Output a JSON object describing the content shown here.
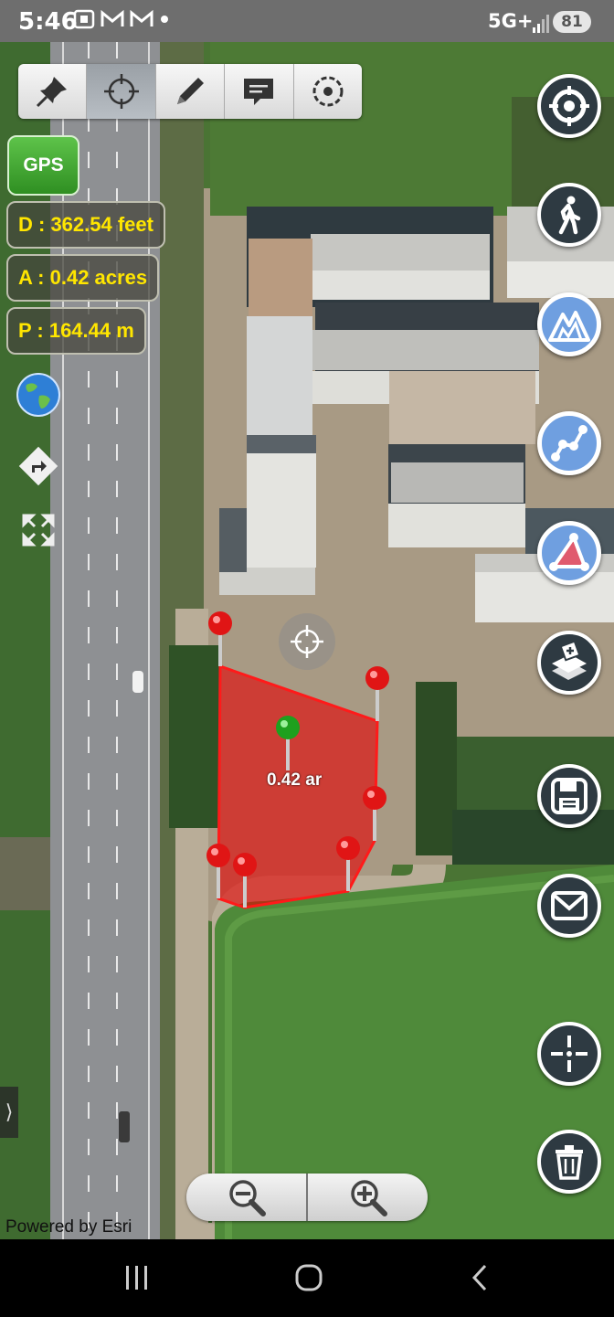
{
  "status_bar": {
    "time": "5:46",
    "notification_icons": [
      "screenshot-icon",
      "gmail-icon",
      "gmail-icon",
      "dot-icon"
    ],
    "network": "5G+",
    "battery": "81"
  },
  "toolbar": {
    "tools": [
      {
        "name": "pin-tool",
        "icon": "pushpin-icon",
        "active": false
      },
      {
        "name": "gps-tool",
        "icon": "crosshair-icon",
        "active": true
      },
      {
        "name": "draw-tool",
        "icon": "pencil-icon",
        "active": false
      },
      {
        "name": "comment-tool",
        "icon": "comment-icon",
        "active": false
      },
      {
        "name": "settings-tool",
        "icon": "target-icon",
        "active": false
      }
    ]
  },
  "measurements": {
    "gps_label": "GPS",
    "distance": "D : 362.54 feet",
    "area": "A : 0.42 acres",
    "perimeter": "P : 164.44 m"
  },
  "map": {
    "polygon_label": "0.42 ar",
    "attribution": "Powered by Esri",
    "drawer_handle": "⟩",
    "polygon_color": "#e60000",
    "pin_color": "#e01515",
    "center_pin_color": "#1ea01e"
  },
  "right_buttons": [
    {
      "name": "locate-button",
      "icon": "locate-icon"
    },
    {
      "name": "walk-mode-button",
      "icon": "walking-icon"
    },
    {
      "name": "elevation-button",
      "icon": "mountain-icon"
    },
    {
      "name": "line-measure-button",
      "icon": "path-icon"
    },
    {
      "name": "area-measure-button",
      "icon": "triangle-icon"
    },
    {
      "name": "add-layer-button",
      "icon": "layer-add-icon"
    },
    {
      "name": "save-button",
      "icon": "floppy-icon"
    },
    {
      "name": "email-button",
      "icon": "mail-icon"
    },
    {
      "name": "center-button",
      "icon": "center-crosshair-icon"
    },
    {
      "name": "delete-button",
      "icon": "trash-icon"
    }
  ]
}
